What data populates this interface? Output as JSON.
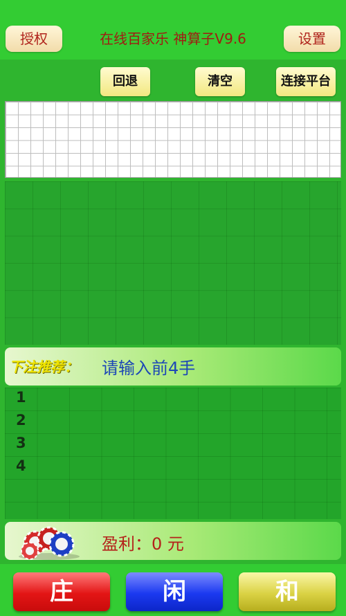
{
  "header": {
    "auth_label": "授权",
    "title": "在线百家乐 神算子V9.6",
    "settings_label": "设置"
  },
  "toolbar": {
    "undo_label": "回退",
    "clear_label": "清空",
    "connect_label": "连接平台"
  },
  "recommendation": {
    "label": "下注推荐：",
    "text": "请输入前4手"
  },
  "hands": [
    "1",
    "2",
    "3",
    "4"
  ],
  "profit": {
    "text": "盈利：0 元"
  },
  "bets": {
    "banker": "庄",
    "player": "闲",
    "tie": "和"
  },
  "colors": {
    "background": "#2fb52f",
    "banker": "#e31515",
    "player": "#1b39f0",
    "tie": "#dad244"
  }
}
